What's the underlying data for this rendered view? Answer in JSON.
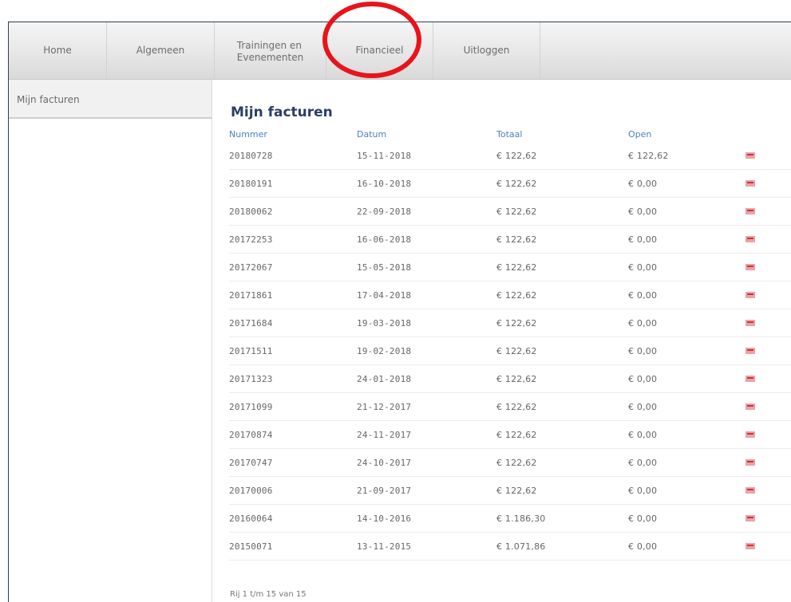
{
  "nav": {
    "items": [
      {
        "label": "Home"
      },
      {
        "label": "Algemeen"
      },
      {
        "label": "Trainingen en\nEvenementen"
      },
      {
        "label": "Financieel"
      },
      {
        "label": "Uitloggen"
      }
    ]
  },
  "sidebar": {
    "items": [
      {
        "label": "Mijn facturen"
      }
    ]
  },
  "main": {
    "title": "Mijn facturen",
    "columns": [
      "Nummer",
      "Datum",
      "Totaal",
      "Open"
    ],
    "rows": [
      {
        "nummer": "20180728",
        "datum": "15-11-2018",
        "totaal": "€ 122,62",
        "open": "€ 122,62"
      },
      {
        "nummer": "20180191",
        "datum": "16-10-2018",
        "totaal": "€ 122,62",
        "open": "€ 0,00"
      },
      {
        "nummer": "20180062",
        "datum": "22-09-2018",
        "totaal": "€ 122,62",
        "open": "€ 0,00"
      },
      {
        "nummer": "20172253",
        "datum": "16-06-2018",
        "totaal": "€ 122,62",
        "open": "€ 0,00"
      },
      {
        "nummer": "20172067",
        "datum": "15-05-2018",
        "totaal": "€ 122,62",
        "open": "€ 0,00"
      },
      {
        "nummer": "20171861",
        "datum": "17-04-2018",
        "totaal": "€ 122,62",
        "open": "€ 0,00"
      },
      {
        "nummer": "20171684",
        "datum": "19-03-2018",
        "totaal": "€ 122,62",
        "open": "€ 0,00"
      },
      {
        "nummer": "20171511",
        "datum": "19-02-2018",
        "totaal": "€ 122,62",
        "open": "€ 0,00"
      },
      {
        "nummer": "20171323",
        "datum": "24-01-2018",
        "totaal": "€ 122,62",
        "open": "€ 0,00"
      },
      {
        "nummer": "20171099",
        "datum": "21-12-2017",
        "totaal": "€ 122,62",
        "open": "€ 0,00"
      },
      {
        "nummer": "20170874",
        "datum": "24-11-2017",
        "totaal": "€ 122,62",
        "open": "€ 0,00"
      },
      {
        "nummer": "20170747",
        "datum": "24-10-2017",
        "totaal": "€ 122,62",
        "open": "€ 0,00"
      },
      {
        "nummer": "20170006",
        "datum": "21-09-2017",
        "totaal": "€ 122,62",
        "open": "€ 0,00"
      },
      {
        "nummer": "20160064",
        "datum": "14-10-2016",
        "totaal": "€ 1.186,30",
        "open": "€ 0,00"
      },
      {
        "nummer": "20150071",
        "datum": "13-11-2015",
        "totaal": "€ 1.071,86",
        "open": "€ 0,00"
      }
    ],
    "row_icon": "pdf-icon",
    "pagination_text": "Rij 1 t/m 15 van 15"
  },
  "colors": {
    "title": "#2a3f66",
    "header_link": "#4d7fc6",
    "highlight": "#e8141b",
    "pdf_icon": "#d2303a"
  }
}
